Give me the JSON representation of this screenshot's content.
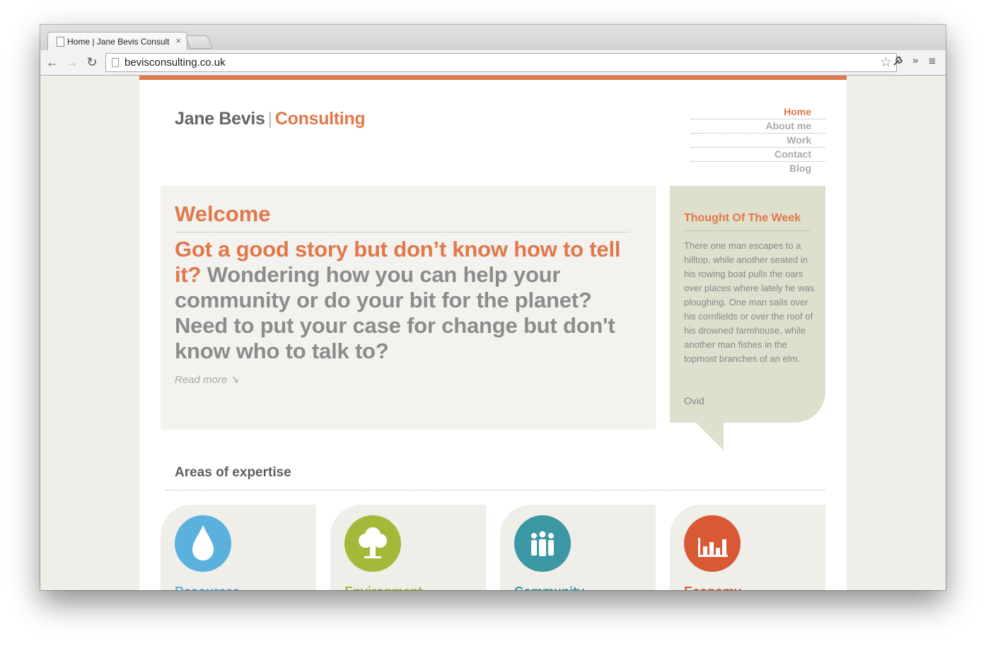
{
  "browser": {
    "tab_title": "Home | Jane Bevis Consult",
    "tab_close": "×",
    "url": "bevisconsulting.co.uk",
    "back_icon": "←",
    "forward_icon": "→",
    "reload_icon": "↻",
    "star_icon": "☆",
    "wrench_icon": "🔧",
    "extensions_icon": "»",
    "menu_icon": "≡"
  },
  "site": {
    "logo_name": "Jane Bevis",
    "logo_sep": "|",
    "logo_brand": "Consulting",
    "accent": "#e0784a",
    "nav": [
      {
        "label": "Home",
        "active": true
      },
      {
        "label": "About me",
        "active": false
      },
      {
        "label": "Work",
        "active": false
      },
      {
        "label": "Contact",
        "active": false
      },
      {
        "label": "Blog",
        "active": false
      }
    ]
  },
  "welcome": {
    "heading": "Welcome",
    "lead_highlight": "Got a good story but don’t know how to tell it?",
    "lead_rest": "Wondering how you can help your community or do your bit for the planet? Need to put your case for change but don't know who to talk to?",
    "read_more": "Read more ➘"
  },
  "thought": {
    "heading": "Thought Of The Week",
    "quote": "There one man escapes to a hilltop, while another seated in his rowing boat pulls the oars over places where lately he was ploughing. One man sails over his cornfields or over the roof of his drowned farmhouse, while another man fishes in the topmost branches of an elm.",
    "author": "Ovid"
  },
  "expertise": {
    "title": "Areas of expertise",
    "cards": [
      {
        "label": "Resources",
        "icon": "water-drop-icon",
        "color": "#5bb1dd"
      },
      {
        "label": "Environment",
        "icon": "tree-icon",
        "color": "#a4b93a"
      },
      {
        "label": "Community",
        "icon": "people-icon",
        "color": "#3a97a3"
      },
      {
        "label": "Economy",
        "icon": "bar-chart-icon",
        "color": "#d95934"
      }
    ]
  }
}
